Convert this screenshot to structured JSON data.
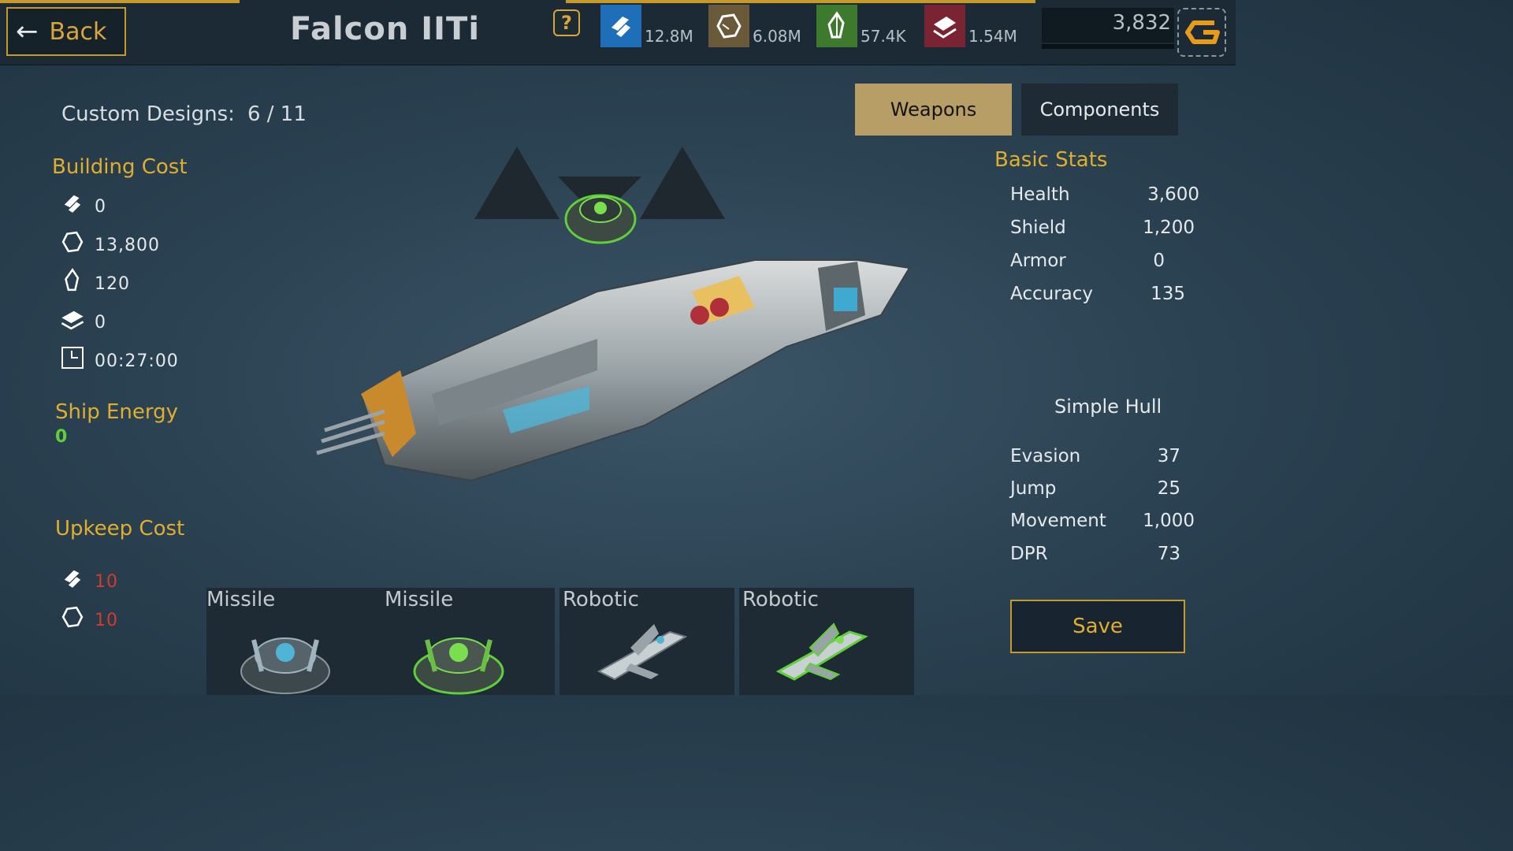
{
  "header": {
    "back_label": "Back",
    "ship_name": "Falcon IITi",
    "help_label": "?",
    "resources": [
      {
        "icon": "energy-icon",
        "value": "12.8M"
      },
      {
        "icon": "ore-icon",
        "value": "6.08M"
      },
      {
        "icon": "crystal-icon",
        "value": "57.4K"
      },
      {
        "icon": "alloy-icon",
        "value": "1.54M"
      }
    ],
    "credits": "3,832",
    "currency_icon": "g-currency-icon"
  },
  "designs": {
    "label": "Custom Designs:",
    "value": "6 / 11"
  },
  "building_cost": {
    "title": "Building Cost",
    "items": [
      {
        "icon": "energy-icon",
        "value": "0"
      },
      {
        "icon": "ore-icon",
        "value": "13,800"
      },
      {
        "icon": "crystal-icon",
        "value": "120"
      },
      {
        "icon": "alloy-icon",
        "value": "0"
      },
      {
        "icon": "clock-icon",
        "value": "00:27:00"
      }
    ]
  },
  "ship_energy": {
    "title": "Ship Energy",
    "value": "0"
  },
  "upkeep_cost": {
    "title": "Upkeep Cost",
    "items": [
      {
        "icon": "energy-icon",
        "value": "10"
      },
      {
        "icon": "ore-icon",
        "value": "10"
      }
    ]
  },
  "tabs": [
    {
      "label": "Weapons",
      "active": true
    },
    {
      "label": "Components",
      "active": false
    }
  ],
  "basic_stats": {
    "title": "Basic Stats",
    "rows": [
      {
        "label": "Health",
        "value": "3,600"
      },
      {
        "label": "Shield",
        "value": "1,200"
      },
      {
        "label": "Armor",
        "value": "0"
      },
      {
        "label": "Accuracy",
        "value": "135"
      }
    ]
  },
  "hull": {
    "title": "Simple Hull",
    "rows": [
      {
        "label": "Evasion",
        "value": "37"
      },
      {
        "label": "Jump",
        "value": "25"
      },
      {
        "label": "Movement",
        "value": "1,000"
      },
      {
        "label": "DPR",
        "value": "73"
      }
    ]
  },
  "weapon_slots": [
    {
      "label": "Missile",
      "icon": "missile-turret-icon"
    },
    {
      "label": "Missile",
      "icon": "missile-turret-green-icon"
    },
    {
      "label": "Robotic",
      "icon": "drone-icon"
    },
    {
      "label": "Robotic",
      "icon": "drone-green-icon"
    }
  ],
  "save_label": "Save",
  "colors": {
    "accent_gold": "#e0ae2f",
    "upkeep_red": "#d53a2a",
    "energy_green": "#5fd03a",
    "active_tab": "#b79d66"
  }
}
